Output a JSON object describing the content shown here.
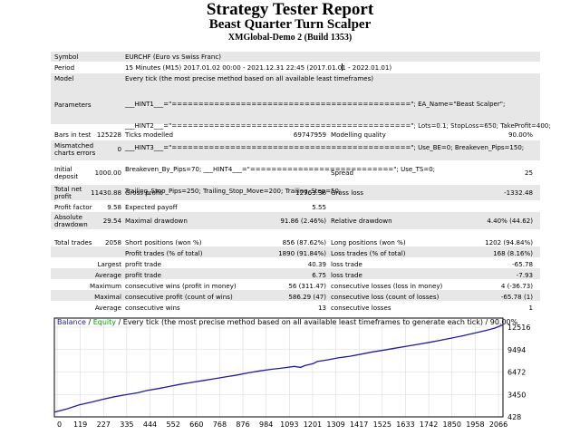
{
  "header": {
    "title": "Strategy Tester Report",
    "expert": "Beast Quarter Turn Scalper",
    "server": "XMGlobal-Demo 2 (Build 1353)"
  },
  "settings": {
    "symbol_label": "Symbol",
    "symbol_value": "EURCHF (Euro vs Swiss Franc)",
    "period_label": "Period",
    "period_value": "15 Minutes (M15) 2017.01.02 00:00 - 2021.12.31 22:45 (2017.01.01 - 2022.01.01)",
    "model_label": "Model",
    "model_value": "Every tick (the most precise method based on all available least timeframes)",
    "parameters_label": "Parameters",
    "parameters_lines": [
      "___HINT1___=\"=============================================\"; EA_Name=\"Beast Scalper\";",
      "___HINT2___=\"=============================================\"; Lots=0.1; StopLoss=650; TakeProfit=400;",
      "___HINT3___=\"=============================================\"; Use_BE=0; Breakeven_Pips=150;",
      "Breakeven_By_Pips=70; ___HINT4___=\"===========================\"; Use_TS=0;",
      "Trailing_Stop_Pips=250; Trailing_Stop_Move=200; Trailing_Step=50;"
    ]
  },
  "stats": {
    "bars_label": "Bars in test",
    "bars_value": "125228",
    "ticks_label": "Ticks modelled",
    "ticks_value": "69747959",
    "quality_label": "Modelling quality",
    "quality_value": "90.00%",
    "mismatched_label_1": "Mismatched",
    "mismatched_label_2": "charts errors",
    "mismatched_value": "0",
    "deposit_label_1": "Initial",
    "deposit_label_2": "deposit",
    "deposit_value": "1000.00",
    "spread_label": "Spread",
    "spread_value": "25",
    "netprofit_label_1": "Total net",
    "netprofit_label_2": "profit",
    "netprofit_value": "11430.88",
    "grossprofit_label": "Gross profit",
    "grossprofit_value": "12763.36",
    "grossloss_label": "Gross loss",
    "grossloss_value": "-1332.48",
    "pf_label": "Profit factor",
    "pf_value": "9.58",
    "payoff_label": "Expected payoff",
    "payoff_value": "5.55",
    "absdd_label_1": "Absolute",
    "absdd_label_2": "drawdown",
    "absdd_value": "29.54",
    "maxdd_label": "Maximal drawdown",
    "maxdd_value": "91.86 (2.46%)",
    "reldd_label": "Relative drawdown",
    "reldd_value": "4.40% (44.62)",
    "trades_label": "Total trades",
    "trades_value": "2058",
    "short_label": "Short positions (won %)",
    "short_value": "856 (87.62%)",
    "long_label": "Long positions (won %)",
    "long_value": "1202 (94.84%)",
    "profit_trades_label": "Profit trades (% of total)",
    "profit_trades_value": "1890 (91.84%)",
    "loss_trades_label": "Loss trades (% of total)",
    "loss_trades_value": "168 (8.16%)",
    "largest_label": "Largest",
    "largest_profit_label": "profit trade",
    "largest_profit_value": "40.39",
    "largest_loss_label": "loss trade",
    "largest_loss_value": "-65.78",
    "average_label": "Average",
    "average_profit_label": "profit trade",
    "average_profit_value": "6.75",
    "average_loss_label": "loss trade",
    "average_loss_value": "-7.93",
    "maximum_label": "Maximum",
    "max_wins_label": "consecutive wins (profit in money)",
    "max_wins_value": "56 (311.47)",
    "max_losses_label": "consecutive losses (loss in money)",
    "max_losses_value": "4 (-36.73)",
    "maximal_label": "Maximal",
    "maximal_profit_label": "consecutive profit (count of wins)",
    "maximal_profit_value": "586.29 (47)",
    "maximal_loss_label": "consecutive loss (count of losses)",
    "maximal_loss_value": "-65.78 (1)",
    "avg_cons_label": "Average",
    "avg_wins_label": "consecutive wins",
    "avg_wins_value": "13",
    "avg_losses_label": "consecutive losses",
    "avg_losses_value": "1"
  },
  "chart_legend": {
    "balance": "Balance",
    "sep1": " / ",
    "equity": "Equity",
    "rest": " / Every tick (the most precise method based on all available least timeframes to generate each tick) / 90.00%"
  },
  "colors": {
    "balance": "#1e1ea0",
    "equity": "#00a000",
    "grid": "#d8d8d8",
    "row_alt": "#e7e7e7"
  },
  "chart_data": {
    "type": "line",
    "x_ticks": [
      "0",
      "119",
      "227",
      "335",
      "444",
      "552",
      "660",
      "768",
      "876",
      "984",
      "1093",
      "1201",
      "1309",
      "1417",
      "1525",
      "1633",
      "1742",
      "1850",
      "1958",
      "2066"
    ],
    "y_ticks": [
      "12516",
      "9494",
      "6472",
      "3450",
      "428"
    ],
    "xlim": [
      0,
      2150
    ],
    "ylim": [
      428,
      12516
    ],
    "series": [
      {
        "name": "Balance",
        "x": [
          0,
          60,
          119,
          180,
          227,
          290,
          335,
          400,
          444,
          500,
          552,
          600,
          660,
          720,
          768,
          820,
          876,
          930,
          984,
          1040,
          1093,
          1150,
          1180,
          1201,
          1240,
          1260,
          1309,
          1360,
          1417,
          1470,
          1525,
          1580,
          1633,
          1690,
          1742,
          1800,
          1850,
          1900,
          1958,
          2010,
          2066,
          2110,
          2150
        ],
        "y": [
          1000,
          1400,
          1900,
          2250,
          2550,
          2900,
          3100,
          3380,
          3650,
          3900,
          4150,
          4400,
          4650,
          4900,
          5100,
          5320,
          5550,
          5820,
          6050,
          6250,
          6400,
          6600,
          6480,
          6700,
          6950,
          7200,
          7400,
          7650,
          7850,
          8100,
          8380,
          8600,
          8830,
          9080,
          9300,
          9550,
          9800,
          10050,
          10350,
          10650,
          11000,
          11280,
          11700
        ]
      }
    ]
  }
}
